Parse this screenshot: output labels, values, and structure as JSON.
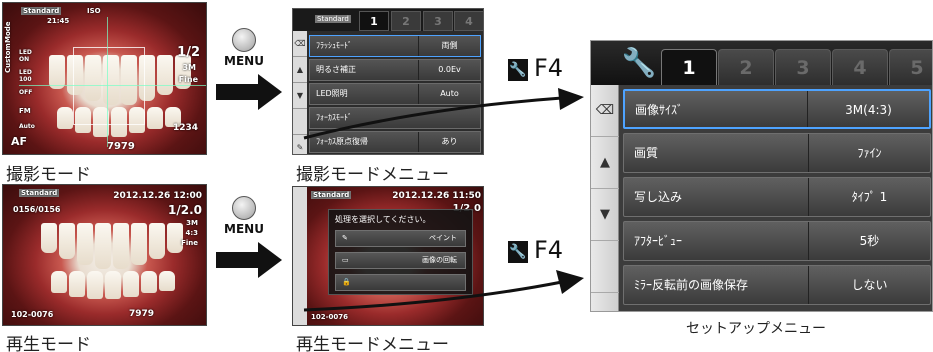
{
  "captions": {
    "shooting_mode": "撮影モード",
    "playback_mode": "再生モード",
    "shooting_menu": "撮影モードメニュー",
    "playback_menu": "再生モードメニュー",
    "setup_menu": "セットアップメニュー"
  },
  "menu_button_label": "MENU",
  "shortcut_label": "F4",
  "shooting_osd": {
    "mode_badge": "Standard",
    "time": "21:45",
    "iso": "ISO",
    "fraction": "1/2",
    "size": "3M",
    "quality": "Fine",
    "count": "1234",
    "af": "AF",
    "af_num": "7979",
    "side_labels": [
      "Mode",
      "Custom",
      "LED ON",
      "LED 100",
      "OFF",
      "FM",
      "Auto"
    ]
  },
  "playback_osd": {
    "mode_badge": "Standard",
    "datetime": "2012.12.26 12:00",
    "frame_counter": "0156/0156",
    "fraction": "1/2.0",
    "size": "3M",
    "ratio": "4:3",
    "quality": "Fine",
    "file": "102-0076",
    "num": "7979"
  },
  "shooting_menu_screen": {
    "badge": "Standard",
    "tabs": [
      "1",
      "2",
      "3",
      "4"
    ],
    "rows": [
      {
        "label": "ﾌﾗｯｼｭﾓｰﾄﾞ",
        "value": "両側"
      },
      {
        "label": "明るさ補正",
        "value": "0.0Ev"
      },
      {
        "label": "LED照明",
        "value": "Auto"
      },
      {
        "label": "ﾌｫｰｶｽﾓｰﾄﾞ",
        "value": ""
      },
      {
        "label": "ﾌｫｰｶｽ原点復帰",
        "value": "あり"
      }
    ]
  },
  "playback_menu_screen": {
    "badge": "Standard",
    "datetime": "2012.12.26 11:50",
    "fraction": "1/2.0",
    "file": "102-0076",
    "dialog_title": "処理を選択してください。",
    "options": [
      {
        "icon": "✎",
        "label": "ペイント"
      },
      {
        "icon": "▭",
        "label": "画像の回転"
      },
      {
        "icon": "🔒",
        "label": ""
      }
    ]
  },
  "setup_menu_screen": {
    "tabs": [
      "1",
      "2",
      "3",
      "4",
      "5"
    ],
    "side_buttons": [
      "⌫",
      "▲",
      "▼"
    ],
    "rows": [
      {
        "label": "画像ｻｲｽﾞ",
        "value": "3M(4:3)"
      },
      {
        "label": "画質",
        "value": "ﾌｧｲﾝ"
      },
      {
        "label": "写し込み",
        "value": "ﾀｲﾌﾟ 1"
      },
      {
        "label": "ｱﾌﾀｰﾋﾞｭｰ",
        "value": "5秒"
      },
      {
        "label": "ﾐﾗｰ反転前の画像保存",
        "value": "しない"
      }
    ]
  }
}
